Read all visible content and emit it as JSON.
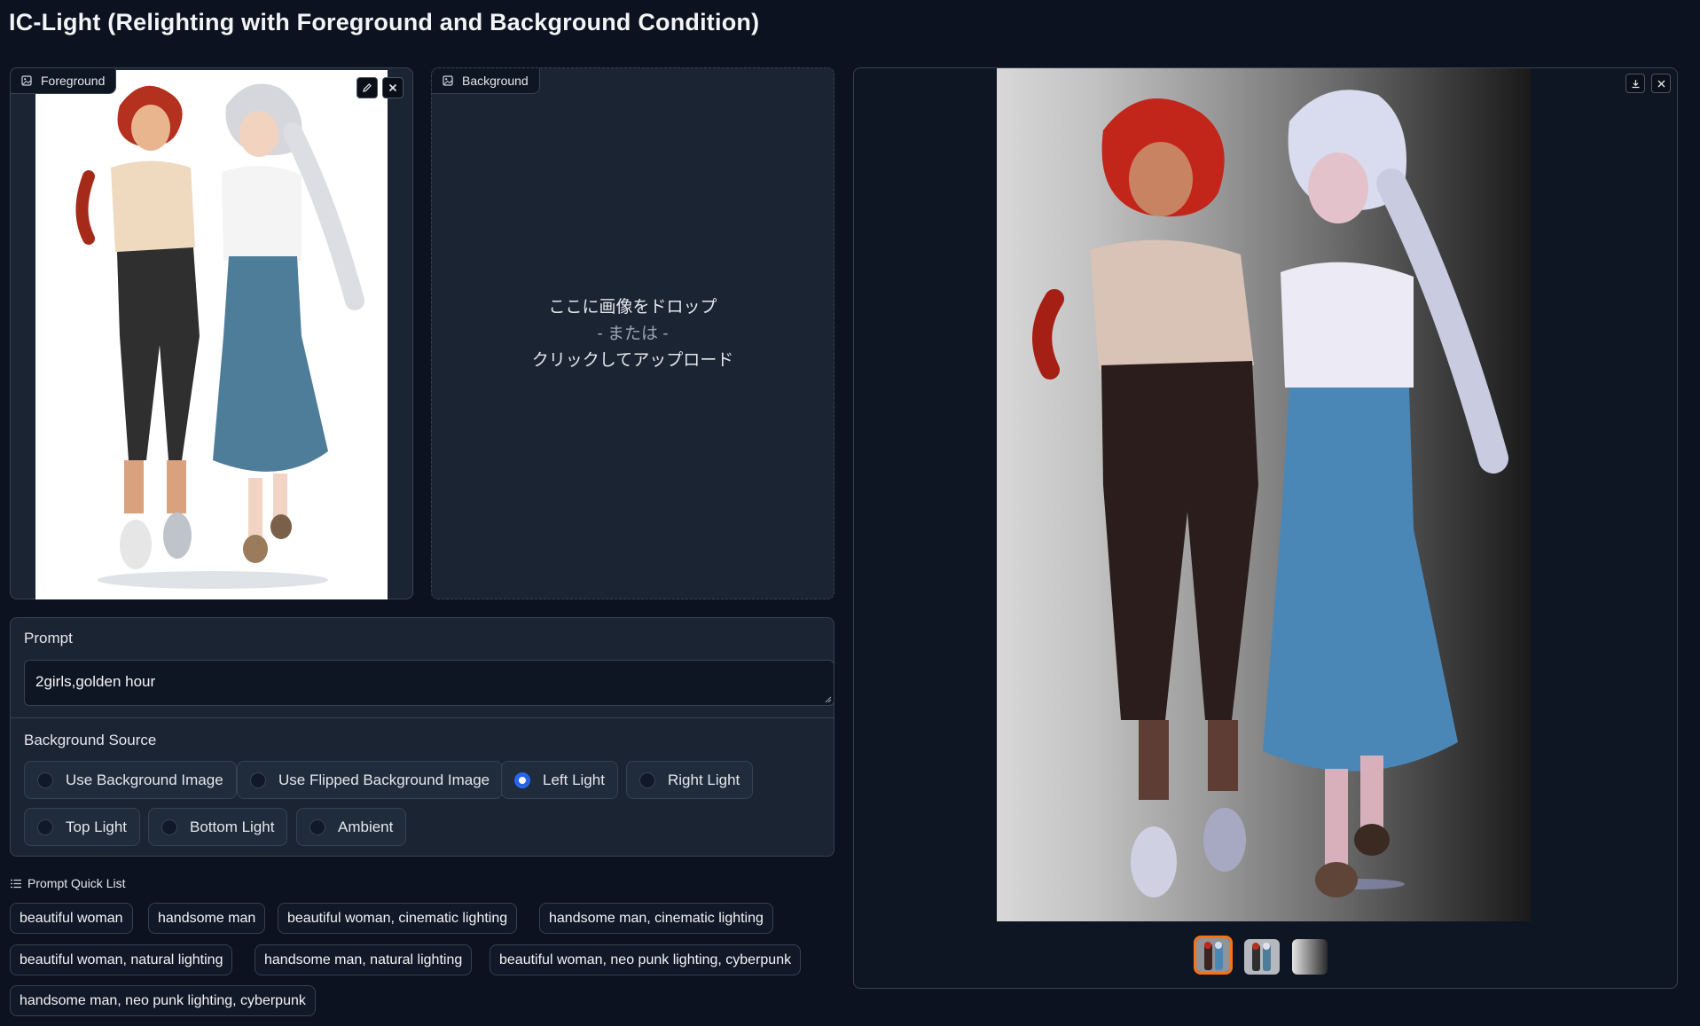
{
  "app": {
    "title": "IC-Light (Relighting with Foreground and Background Condition)"
  },
  "foreground": {
    "label": "Foreground",
    "icon": "image-icon",
    "actions": [
      "edit-icon",
      "close-icon"
    ]
  },
  "background": {
    "label": "Background",
    "icon": "image-icon",
    "drop_line1": "ここに画像をドロップ",
    "drop_or": "- または -",
    "drop_line2": "クリックしてアップロード"
  },
  "prompt": {
    "label": "Prompt",
    "value": "2girls,golden hour"
  },
  "background_source": {
    "label": "Background Source",
    "options": [
      {
        "label": "Use Background Image",
        "selected": false
      },
      {
        "label": "Use Flipped Background Image",
        "selected": false
      },
      {
        "label": "Left Light",
        "selected": true
      },
      {
        "label": "Right Light",
        "selected": false
      },
      {
        "label": "Top Light",
        "selected": false
      },
      {
        "label": "Bottom Light",
        "selected": false
      },
      {
        "label": "Ambient",
        "selected": false
      }
    ]
  },
  "quick_list": {
    "label": "Prompt Quick List",
    "items": [
      "beautiful woman",
      "handsome man",
      "beautiful woman, cinematic lighting",
      "handsome man, cinematic lighting",
      "beautiful woman, natural lighting",
      "handsome man, natural lighting",
      "beautiful woman, neo punk lighting, cyberpunk",
      "handsome man, neo punk lighting, cyberpunk"
    ]
  },
  "output": {
    "actions": [
      "download-icon",
      "close-icon"
    ],
    "thumbnails": 3,
    "selected_thumbnail": 0
  },
  "colors": {
    "page_bg": "#0c1220",
    "panel_bg": "#1b2433",
    "accent_radio": "#2563eb",
    "thumb_selected": "#f97316"
  }
}
